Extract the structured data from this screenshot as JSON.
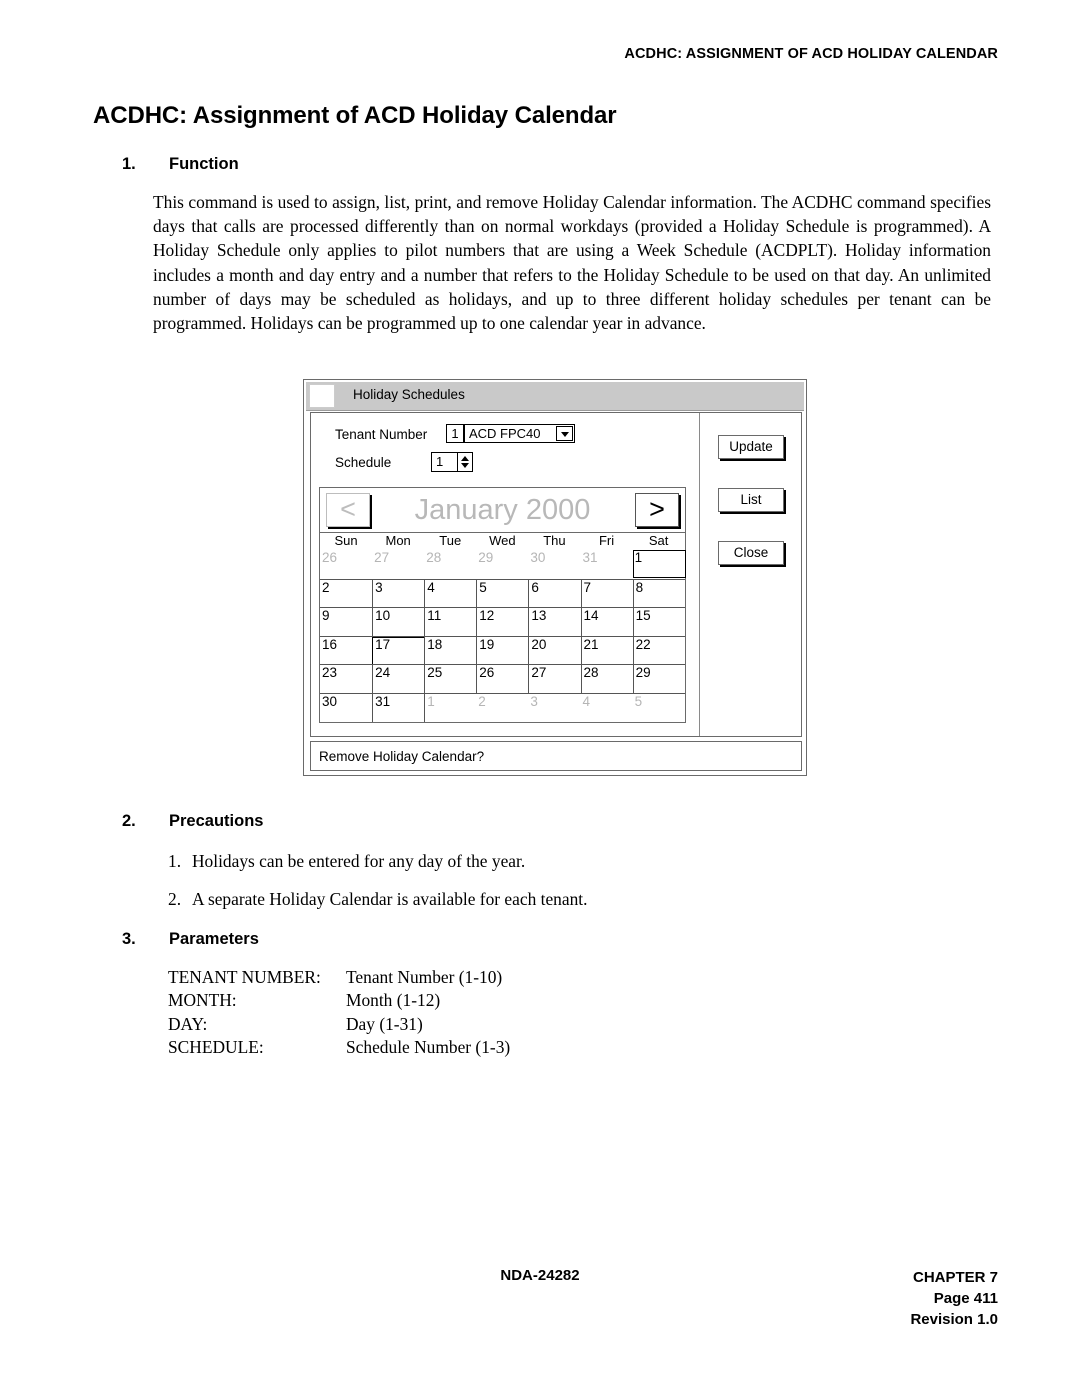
{
  "running_head": "ACDHC: ASSIGNMENT OF ACD HOLIDAY CALENDAR",
  "page_title": "ACDHC: Assignment of ACD Holiday Calendar",
  "sections": {
    "function": {
      "number": "1.",
      "title": "Function"
    },
    "precautions": {
      "number": "2.",
      "title": "Precautions"
    },
    "parameters": {
      "number": "3.",
      "title": "Parameters"
    }
  },
  "function_text": "This command is used to assign, list, print, and remove Holiday Calendar information. The ACDHC command specifies days that calls are processed differently than on normal workdays (provided a Holiday Schedule is programmed). A Holiday Schedule only applies to pilot numbers that are using a Week Schedule (ACDPLT). Holiday information includes a month and day entry and a number that refers to the Holiday Schedule to be used on that day. An unlimited number of days may be scheduled as holidays, and up to three different holiday schedules per tenant can be programmed. Holidays can be programmed up to one calendar year in advance.",
  "precautions": [
    {
      "number": "1.",
      "text": "Holidays can be entered for any day of the year."
    },
    {
      "number": "2.",
      "text": "A separate Holiday Calendar is available for each tenant."
    }
  ],
  "parameters": [
    {
      "key": "TENANT NUMBER:",
      "value": "Tenant Number (1-10)"
    },
    {
      "key": "MONTH:",
      "value": "Month (1-12)"
    },
    {
      "key": "DAY:",
      "value": "Day (1-31)"
    },
    {
      "key": "SCHEDULE:",
      "value": "Schedule Number (1-3)"
    }
  ],
  "dialog": {
    "title": "Holiday Schedules",
    "fields": {
      "tenant_label": "Tenant Number",
      "tenant_index": "1",
      "tenant_value": "ACD FPC40",
      "schedule_label": "Schedule",
      "schedule_value": "1"
    },
    "calendar": {
      "month_label": "January 2000",
      "prev_arrow": "<",
      "next_arrow": ">",
      "day_headers": [
        "Sun",
        "Mon",
        "Tue",
        "Wed",
        "Thu",
        "Fri",
        "Sat"
      ],
      "weeks": [
        [
          {
            "d": "26",
            "muted": true
          },
          {
            "d": "27",
            "muted": true
          },
          {
            "d": "28",
            "muted": true
          },
          {
            "d": "29",
            "muted": true
          },
          {
            "d": "30",
            "muted": true
          },
          {
            "d": "31",
            "muted": true
          },
          {
            "d": "1",
            "muted": false,
            "selected": true
          }
        ],
        [
          {
            "d": "2"
          },
          {
            "d": "3"
          },
          {
            "d": "4"
          },
          {
            "d": "5"
          },
          {
            "d": "6"
          },
          {
            "d": "7"
          },
          {
            "d": "8"
          }
        ],
        [
          {
            "d": "9"
          },
          {
            "d": "10"
          },
          {
            "d": "11"
          },
          {
            "d": "12"
          },
          {
            "d": "13"
          },
          {
            "d": "14"
          },
          {
            "d": "15"
          }
        ],
        [
          {
            "d": "16"
          },
          {
            "d": "17",
            "selected": true
          },
          {
            "d": "18"
          },
          {
            "d": "19"
          },
          {
            "d": "20"
          },
          {
            "d": "21"
          },
          {
            "d": "22"
          }
        ],
        [
          {
            "d": "23"
          },
          {
            "d": "24"
          },
          {
            "d": "25"
          },
          {
            "d": "26"
          },
          {
            "d": "27"
          },
          {
            "d": "28"
          },
          {
            "d": "29"
          }
        ],
        [
          {
            "d": "30"
          },
          {
            "d": "31"
          },
          {
            "d": "1",
            "muted": true
          },
          {
            "d": "2",
            "muted": true
          },
          {
            "d": "3",
            "muted": true
          },
          {
            "d": "4",
            "muted": true
          },
          {
            "d": "5",
            "muted": true
          }
        ]
      ]
    },
    "buttons": {
      "update": "Update",
      "list": "List",
      "close": "Close"
    },
    "status": "Remove Holiday Calendar?"
  },
  "footer": {
    "doc_number": "NDA-24282",
    "chapter": "CHAPTER 7",
    "page": "Page 411",
    "revision": "Revision 1.0"
  }
}
